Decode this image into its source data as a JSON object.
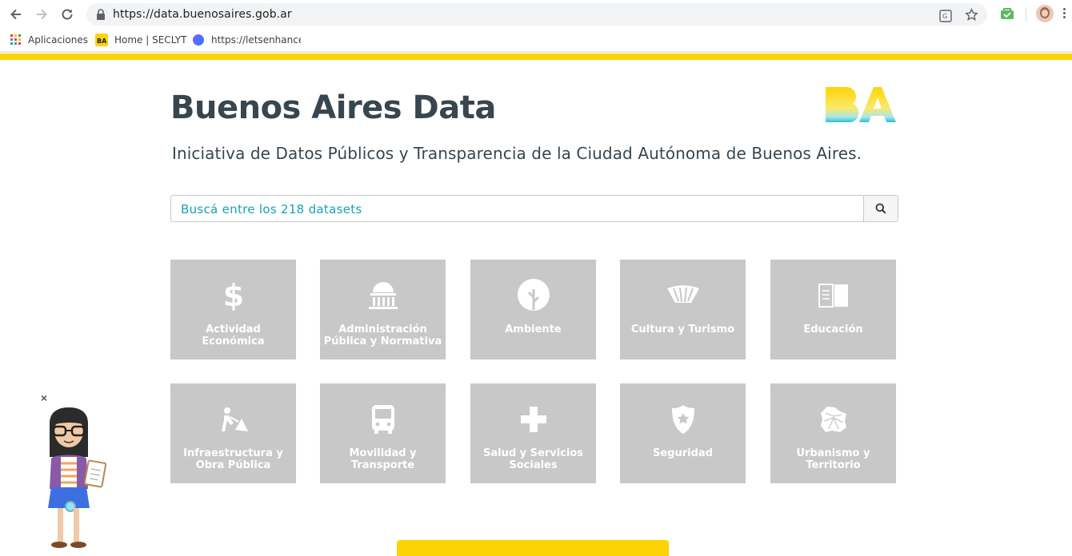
{
  "browser": {
    "url": "https://data.buenosaires.gob.ar",
    "bookmarks": [
      {
        "label": "Aplicaciones"
      },
      {
        "label": "Home | SECLYT"
      },
      {
        "label": "https://letsenhance.io"
      }
    ],
    "colors": {
      "accent": "#fdd306"
    }
  },
  "header": {
    "title": "Buenos Aires Data",
    "logo_text": "BA",
    "subtitle": "Iniciativa de Datos Públicos y Transparencia de la Ciudad Autónoma de Buenos Aires."
  },
  "search": {
    "placeholder": "Buscá entre los 218 datasets",
    "icon": "search-icon"
  },
  "categories": [
    {
      "label": "Actividad Económica",
      "icon": "dollar-icon"
    },
    {
      "label": "Administración Pública y Normativa",
      "icon": "government-building-icon"
    },
    {
      "label": "Ambiente",
      "icon": "tree-icon"
    },
    {
      "label": "Cultura y Turismo",
      "icon": "fan-icon"
    },
    {
      "label": "Educación",
      "icon": "book-icon"
    },
    {
      "label": "Infraestructura y Obra Pública",
      "icon": "construction-worker-icon"
    },
    {
      "label": "Movilidad y Transporte",
      "icon": "bus-icon"
    },
    {
      "label": "Salud y Servicios Sociales",
      "icon": "health-cross-icon"
    },
    {
      "label": "Seguridad",
      "icon": "police-badge-icon"
    },
    {
      "label": "Urbanismo y Territorio",
      "icon": "city-map-icon"
    }
  ],
  "assistant": {
    "close_label": "×"
  }
}
